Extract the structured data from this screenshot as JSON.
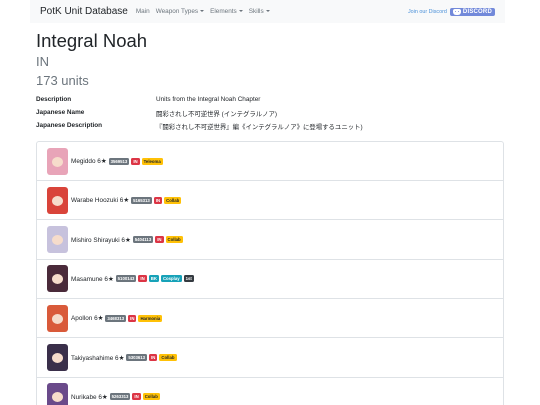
{
  "navbar": {
    "brand": "PotK Unit Database",
    "links": [
      {
        "label": "Main",
        "dropdown": false
      },
      {
        "label": "Weapon Types",
        "dropdown": true
      },
      {
        "label": "Elements",
        "dropdown": true
      },
      {
        "label": "Skills",
        "dropdown": true
      }
    ],
    "join_label": "Join our Discord",
    "discord_label": "DISCORD"
  },
  "page": {
    "title": "Integral Noah",
    "code": "IN",
    "count": "173 units"
  },
  "info": [
    {
      "key": "Description",
      "value": "Units from the Integral Noah Chapter"
    },
    {
      "key": "Japanese Name",
      "value": "闘彩されし不可逆世界 (インテグラルノア)"
    },
    {
      "key": "Japanese Description",
      "value": "『闘彩されし不可逆世界』編《インテグラルノア》に登場するユニット)"
    }
  ],
  "units": [
    {
      "name": "Megiddo 6★",
      "id": "3569513",
      "badges": [
        {
          "text": "IN",
          "kind": "in"
        },
        {
          "text": "Teleoma",
          "kind": "yellow"
        }
      ],
      "hair": "#e8a4b8"
    },
    {
      "name": "Warabe Hoozuki 6★",
      "id": "5165313",
      "badges": [
        {
          "text": "IN",
          "kind": "in"
        },
        {
          "text": "Collab",
          "kind": "yellow"
        }
      ],
      "hair": "#d9443a"
    },
    {
      "name": "Mishiro Shirayuki 6★",
      "id": "5404113",
      "badges": [
        {
          "text": "IN",
          "kind": "in"
        },
        {
          "text": "Collab",
          "kind": "yellow"
        }
      ],
      "hair": "#c7c2dd"
    },
    {
      "name": "Masamune 6★",
      "id": "5100143",
      "badges": [
        {
          "text": "IN",
          "kind": "in"
        },
        {
          "text": "BK",
          "kind": "blue"
        },
        {
          "text": "Cosplay",
          "kind": "blue"
        },
        {
          "text": "1st",
          "kind": "dark"
        }
      ],
      "hair": "#4a2a3a"
    },
    {
      "name": "Apollon 6★",
      "id": "3468313",
      "badges": [
        {
          "text": "IN",
          "kind": "in"
        },
        {
          "text": "Harmonia",
          "kind": "yellow"
        }
      ],
      "hair": "#d95a3a"
    },
    {
      "name": "Takiyashahime 6★",
      "id": "5303613",
      "badges": [
        {
          "text": "IN",
          "kind": "in"
        },
        {
          "text": "Collab",
          "kind": "yellow"
        }
      ],
      "hair": "#3a2f4a"
    },
    {
      "name": "Nurikabe 6★",
      "id": "5263313",
      "badges": [
        {
          "text": "IN",
          "kind": "in"
        },
        {
          "text": "Collab",
          "kind": "yellow"
        }
      ],
      "hair": "#6a4a8a"
    }
  ]
}
